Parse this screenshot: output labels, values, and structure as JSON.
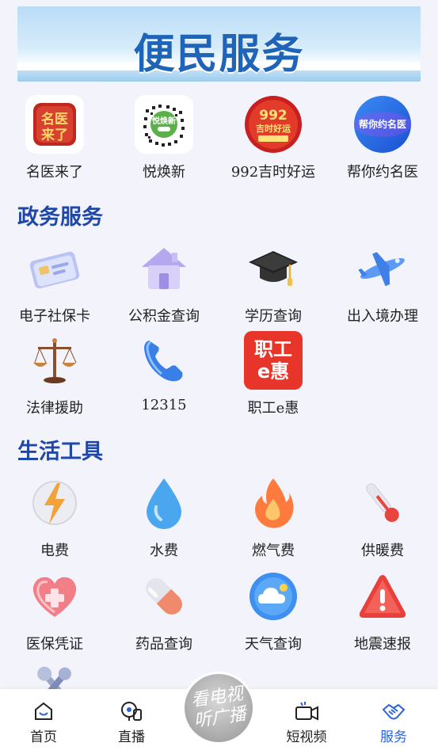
{
  "banner": {
    "title": "便民服务"
  },
  "featured": [
    {
      "label": "名医来了",
      "badge": "名医来了"
    },
    {
      "label": "悦焕新",
      "badge": "悦焕新"
    },
    {
      "label": "992吉时好运",
      "badge": "992吉时好运"
    },
    {
      "label": "帮你约名医",
      "badge": "帮你约名医"
    }
  ],
  "gov": {
    "title": "政务服务",
    "items": [
      {
        "label": "电子社保卡"
      },
      {
        "label": "公积金查询"
      },
      {
        "label": "学历查询"
      },
      {
        "label": "出入境办理"
      },
      {
        "label": "法律援助"
      },
      {
        "label": "12315"
      },
      {
        "label": "职工e惠",
        "badge_line1": "职工",
        "badge_line2": "e惠"
      }
    ]
  },
  "life": {
    "title": "生活工具",
    "items": [
      {
        "label": "电费"
      },
      {
        "label": "水费"
      },
      {
        "label": "燃气费"
      },
      {
        "label": "供暖费"
      },
      {
        "label": "医保凭证"
      },
      {
        "label": "药品查询"
      },
      {
        "label": "天气查询"
      },
      {
        "label": "地震速报"
      }
    ]
  },
  "nav": {
    "home": "首页",
    "live": "直播",
    "center_line1": "看电视",
    "center_line2": "听广播",
    "video": "短视频",
    "service": "服务"
  },
  "colors": {
    "accent": "#2b62d6",
    "section_title": "#1f47a8",
    "banner_title": "#1e64b9"
  }
}
